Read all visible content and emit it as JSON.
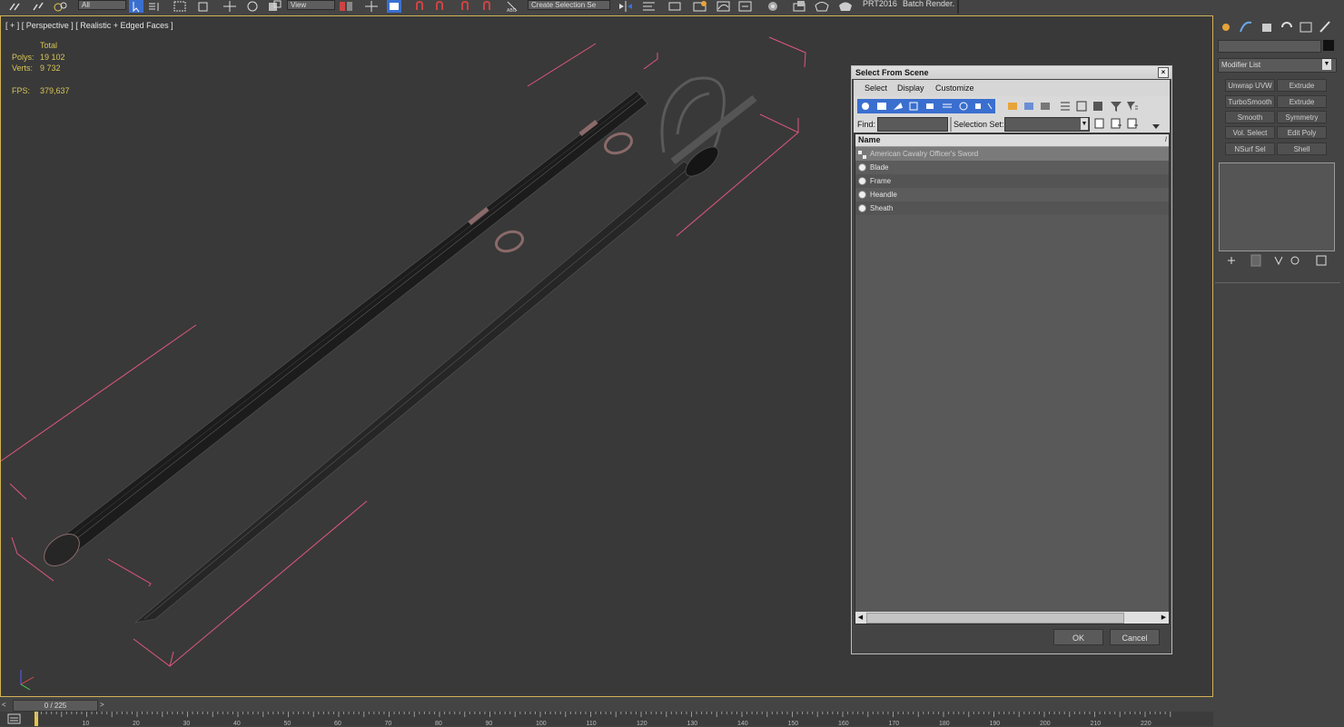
{
  "toolbar": {
    "filter_combo": "All",
    "ref_coord_combo": "View",
    "selection_set_combo": "Create Selection Se",
    "prt_label": "PRT2016",
    "batch_render_label": "Batch Render..."
  },
  "viewport": {
    "label": "[ + ] [ Perspective ] [ Realistic + Edged Faces ]",
    "stats": {
      "total_label": "Total",
      "polys_label": "Polys:",
      "polys_value": "19 102",
      "verts_label": "Verts:",
      "verts_value": "9 732",
      "fps_label": "FPS:",
      "fps_value": "379,637"
    }
  },
  "command_panel": {
    "modifier_list": "Modifier List",
    "buttons": [
      "Unwrap UVW",
      "Extrude",
      "TurboSmooth",
      "Extrude",
      "Smooth",
      "Symmetry",
      "Vol. Select",
      "Edit Poly",
      "NSurf Sel",
      "Shell"
    ]
  },
  "dialog": {
    "title": "Select From Scene",
    "menu": [
      "Select",
      "Display",
      "Customize"
    ],
    "find_label": "Find:",
    "selection_set_label": "Selection Set:",
    "column_name": "Name",
    "items": [
      "American Cavalry Officer's Sword",
      "Blade",
      "Frame",
      "Heandle",
      "Sheath"
    ],
    "ok_label": "OK",
    "cancel_label": "Cancel"
  },
  "timeline": {
    "frame_counter": "0 / 225",
    "ticks": [
      "10",
      "20",
      "30",
      "40",
      "50",
      "60",
      "70",
      "80",
      "90",
      "100",
      "110",
      "120",
      "130",
      "140",
      "150",
      "160",
      "170",
      "180",
      "190",
      "200",
      "210",
      "220"
    ]
  },
  "colors": {
    "viewport_border": "#d2b35a",
    "stat_text": "#d6c456",
    "bbox_pink": "#e0567e",
    "selection_highlight": "#3a6fd0"
  }
}
